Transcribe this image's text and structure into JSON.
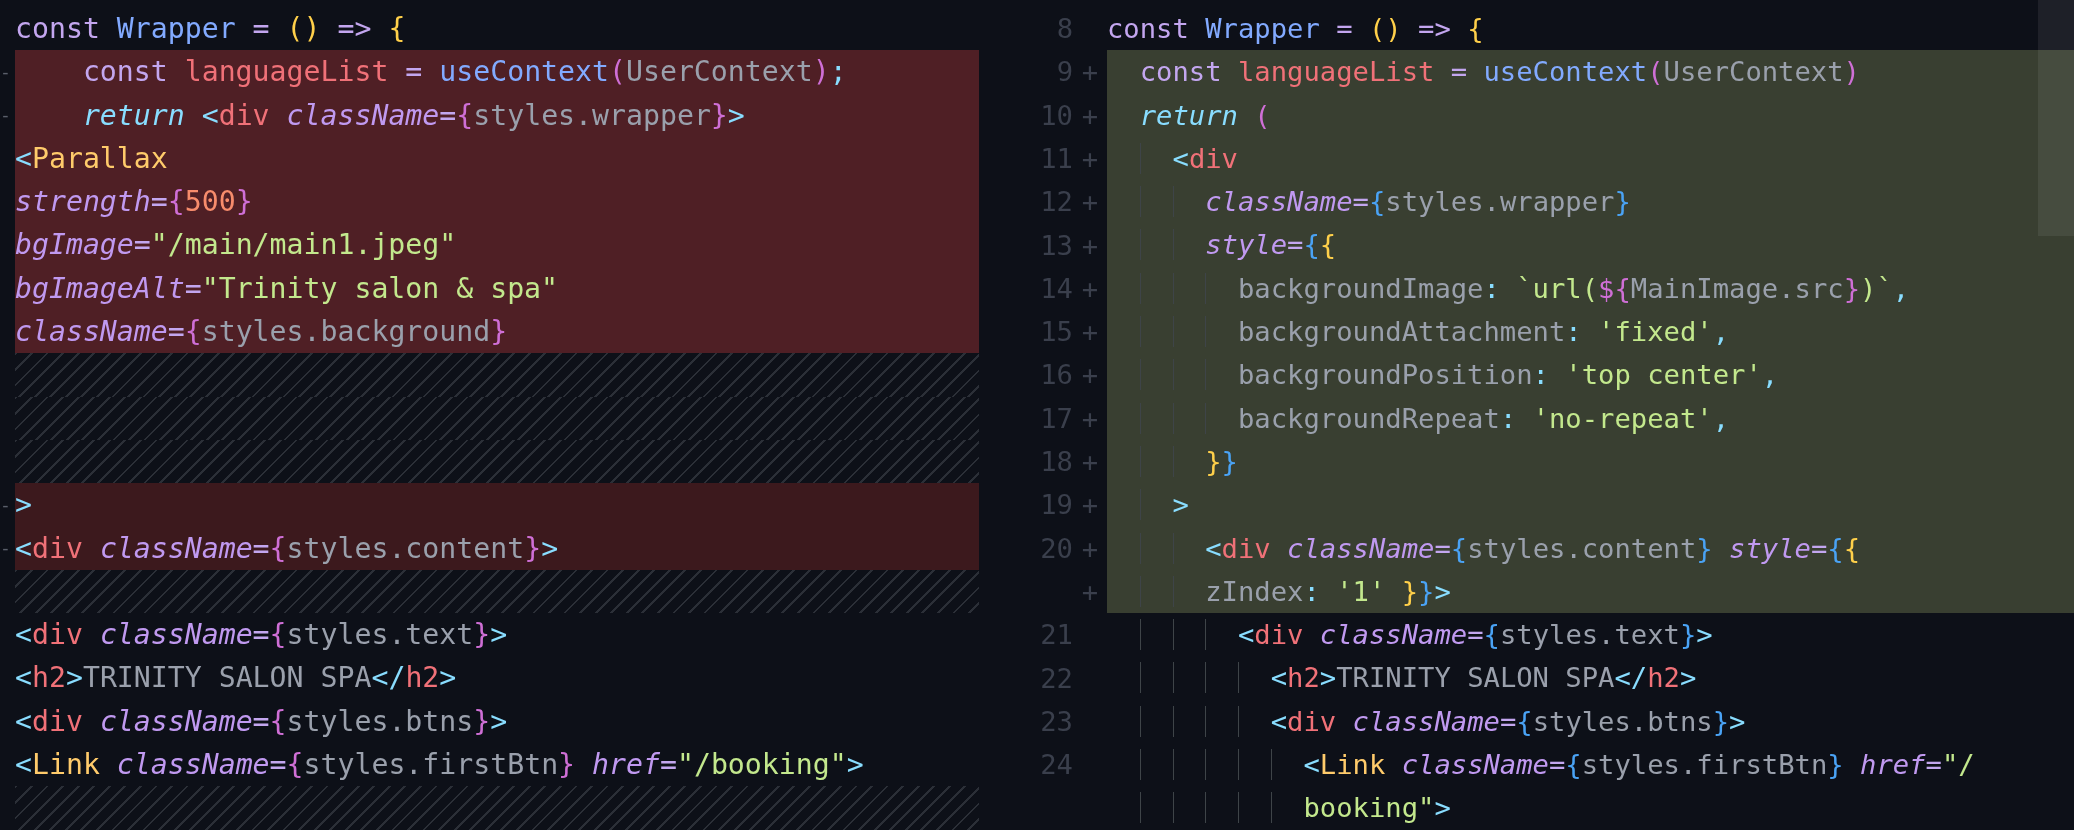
{
  "panes": [
    {
      "kind": "old",
      "lines": [
        {
          "kind": "context",
          "tokens": [
            {
              "text": "const ",
              "kind": "keyword"
            },
            {
              "text": "Wrapper",
              "kind": "function"
            },
            {
              "text": " = ",
              "kind": "op"
            },
            {
              "text": "()",
              "kind": "bracket"
            },
            {
              "text": " => ",
              "kind": "op"
            },
            {
              "text": "{",
              "kind": "bracket"
            }
          ]
        },
        {
          "kind": "removed",
          "marker": "-",
          "tokens": [
            {
              "text": "    const ",
              "kind": "keyword"
            },
            {
              "text": "languageList",
              "kind": "var"
            },
            {
              "text": " = ",
              "kind": "op"
            },
            {
              "text": "useContext",
              "kind": "function"
            },
            {
              "text": "(",
              "kind": "brace"
            },
            {
              "text": "UserContext",
              "kind": "plain"
            },
            {
              "text": ")",
              "kind": "brace"
            },
            {
              "text": ";",
              "kind": "angle"
            }
          ]
        },
        {
          "kind": "removed",
          "marker": "-",
          "tokens": [
            {
              "text": "    return ",
              "kind": "return"
            },
            {
              "text": "<",
              "kind": "angle"
            },
            {
              "text": "div ",
              "kind": "var"
            },
            {
              "text": "className",
              "kind": "attr"
            },
            {
              "text": "=",
              "kind": "op"
            },
            {
              "text": "{",
              "kind": "brace"
            },
            {
              "text": "styles.wrapper",
              "kind": "plain"
            },
            {
              "text": "}",
              "kind": "brace"
            },
            {
              "text": ">",
              "kind": "angle"
            }
          ]
        },
        {
          "kind": "removed",
          "tokens": [
            {
              "text": "<",
              "kind": "angle"
            },
            {
              "text": "Parallax",
              "kind": "component"
            }
          ]
        },
        {
          "kind": "removed",
          "tokens": [
            {
              "text": "strength",
              "kind": "attr"
            },
            {
              "text": "=",
              "kind": "op"
            },
            {
              "text": "{",
              "kind": "brace"
            },
            {
              "text": "500",
              "kind": "number"
            },
            {
              "text": "}",
              "kind": "brace"
            }
          ]
        },
        {
          "kind": "removed",
          "tokens": [
            {
              "text": "bgImage",
              "kind": "attr"
            },
            {
              "text": "=",
              "kind": "op"
            },
            {
              "text": "\"/main/main1.jpeg\"",
              "kind": "string"
            }
          ]
        },
        {
          "kind": "removed",
          "tokens": [
            {
              "text": "bgImageAlt",
              "kind": "attr"
            },
            {
              "text": "=",
              "kind": "op"
            },
            {
              "text": "\"Trinity salon & spa\"",
              "kind": "string"
            }
          ]
        },
        {
          "kind": "removed",
          "tokens": [
            {
              "text": "className",
              "kind": "attr"
            },
            {
              "text": "=",
              "kind": "op"
            },
            {
              "text": "{",
              "kind": "brace"
            },
            {
              "text": "styles.background",
              "kind": "plain"
            },
            {
              "text": "}",
              "kind": "brace"
            }
          ]
        },
        {
          "kind": "filler"
        },
        {
          "kind": "filler"
        },
        {
          "kind": "filler"
        },
        {
          "kind": "removed_dim",
          "marker": "-",
          "tokens": [
            {
              "text": ">",
              "kind": "angle"
            }
          ]
        },
        {
          "kind": "removed_dim",
          "marker": "-",
          "tokens": [
            {
              "text": "<",
              "kind": "angle"
            },
            {
              "text": "div ",
              "kind": "var"
            },
            {
              "text": "className",
              "kind": "attr"
            },
            {
              "text": "=",
              "kind": "op"
            },
            {
              "text": "{",
              "kind": "brace"
            },
            {
              "text": "styles.content",
              "kind": "plain"
            },
            {
              "text": "}",
              "kind": "brace"
            },
            {
              "text": ">",
              "kind": "angle"
            }
          ]
        },
        {
          "kind": "filler"
        },
        {
          "kind": "context",
          "tokens": [
            {
              "text": "<",
              "kind": "angle"
            },
            {
              "text": "div ",
              "kind": "var"
            },
            {
              "text": "className",
              "kind": "attr"
            },
            {
              "text": "=",
              "kind": "op"
            },
            {
              "text": "{",
              "kind": "brace"
            },
            {
              "text": "styles.text",
              "kind": "plain"
            },
            {
              "text": "}",
              "kind": "brace"
            },
            {
              "text": ">",
              "kind": "angle"
            }
          ]
        },
        {
          "kind": "context",
          "tokens": [
            {
              "text": "<",
              "kind": "angle"
            },
            {
              "text": "h2",
              "kind": "var"
            },
            {
              "text": ">",
              "kind": "angle"
            },
            {
              "text": "TRINITY SALON SPA",
              "kind": "plain"
            },
            {
              "text": "</",
              "kind": "angle"
            },
            {
              "text": "h2",
              "kind": "var"
            },
            {
              "text": ">",
              "kind": "angle"
            }
          ]
        },
        {
          "kind": "context",
          "tokens": [
            {
              "text": "<",
              "kind": "angle"
            },
            {
              "text": "div ",
              "kind": "var"
            },
            {
              "text": "className",
              "kind": "attr"
            },
            {
              "text": "=",
              "kind": "op"
            },
            {
              "text": "{",
              "kind": "brace"
            },
            {
              "text": "styles.btns",
              "kind": "plain"
            },
            {
              "text": "}",
              "kind": "brace"
            },
            {
              "text": ">",
              "kind": "angle"
            }
          ]
        },
        {
          "kind": "context",
          "tokens": [
            {
              "text": "<",
              "kind": "angle"
            },
            {
              "text": "Link ",
              "kind": "component"
            },
            {
              "text": "className",
              "kind": "attr"
            },
            {
              "text": "=",
              "kind": "op"
            },
            {
              "text": "{",
              "kind": "brace"
            },
            {
              "text": "styles.firstBtn",
              "kind": "plain"
            },
            {
              "text": "} ",
              "kind": "brace"
            },
            {
              "text": "href",
              "kind": "attr"
            },
            {
              "text": "=",
              "kind": "op"
            },
            {
              "text": "\"/booking\"",
              "kind": "string"
            },
            {
              "text": ">",
              "kind": "angle"
            }
          ]
        },
        {
          "kind": "filler"
        }
      ]
    },
    {
      "kind": "new",
      "lines": [
        {
          "kind": "context",
          "number": "8",
          "tokens": [
            {
              "text": "const ",
              "kind": "keyword"
            },
            {
              "text": "Wrapper",
              "kind": "function"
            },
            {
              "text": " = ",
              "kind": "op"
            },
            {
              "text": "()",
              "kind": "bracket"
            },
            {
              "text": " => ",
              "kind": "op"
            },
            {
              "text": "{",
              "kind": "bracket"
            }
          ]
        },
        {
          "kind": "added",
          "number": "9",
          "marker": "+",
          "tokens": [
            {
              "text": "  const ",
              "kind": "keyword"
            },
            {
              "text": "languageList",
              "kind": "var"
            },
            {
              "text": " = ",
              "kind": "op"
            },
            {
              "text": "useContext",
              "kind": "function"
            },
            {
              "text": "(",
              "kind": "brace"
            },
            {
              "text": "UserContext",
              "kind": "plain"
            },
            {
              "text": ")",
              "kind": "brace"
            }
          ]
        },
        {
          "kind": "added",
          "number": "10",
          "marker": "+",
          "tokens": [
            {
              "text": "  return ",
              "kind": "return"
            },
            {
              "text": "(",
              "kind": "brace"
            }
          ]
        },
        {
          "kind": "added",
          "number": "11",
          "marker": "+",
          "tokens": [
            {
              "text": "    <",
              "kind": "angle"
            },
            {
              "text": "div",
              "kind": "var"
            }
          ]
        },
        {
          "kind": "added",
          "number": "12",
          "marker": "+",
          "tokens": [
            {
              "text": "      className",
              "kind": "attr"
            },
            {
              "text": "=",
              "kind": "op"
            },
            {
              "text": "{",
              "kind": "brace_blue"
            },
            {
              "text": "styles.wrapper",
              "kind": "plain"
            },
            {
              "text": "}",
              "kind": "brace_blue"
            }
          ]
        },
        {
          "kind": "added",
          "number": "13",
          "marker": "+",
          "tokens": [
            {
              "text": "      style",
              "kind": "attr"
            },
            {
              "text": "=",
              "kind": "op"
            },
            {
              "text": "{",
              "kind": "brace_blue"
            },
            {
              "text": "{",
              "kind": "bracket"
            }
          ]
        },
        {
          "kind": "added",
          "number": "14",
          "marker": "+",
          "tokens": [
            {
              "text": "        backgroundImage",
              "kind": "plain"
            },
            {
              "text": ": ",
              "kind": "angle"
            },
            {
              "text": "`url(",
              "kind": "string"
            },
            {
              "text": "${",
              "kind": "brace"
            },
            {
              "text": "MainImage.src",
              "kind": "plain"
            },
            {
              "text": "}",
              "kind": "brace"
            },
            {
              "text": ")`",
              "kind": "string"
            },
            {
              "text": ",",
              "kind": "angle"
            }
          ]
        },
        {
          "kind": "added",
          "number": "15",
          "marker": "+",
          "tokens": [
            {
              "text": "        backgroundAttachment",
              "kind": "plain"
            },
            {
              "text": ": ",
              "kind": "angle"
            },
            {
              "text": "'fixed'",
              "kind": "string"
            },
            {
              "text": ",",
              "kind": "angle"
            }
          ]
        },
        {
          "kind": "added",
          "number": "16",
          "marker": "+",
          "tokens": [
            {
              "text": "        backgroundPosition",
              "kind": "plain"
            },
            {
              "text": ": ",
              "kind": "angle"
            },
            {
              "text": "'top center'",
              "kind": "string"
            },
            {
              "text": ",",
              "kind": "angle"
            }
          ]
        },
        {
          "kind": "added",
          "number": "17",
          "marker": "+",
          "tokens": [
            {
              "text": "        backgroundRepeat",
              "kind": "plain"
            },
            {
              "text": ": ",
              "kind": "angle"
            },
            {
              "text": "'no-repeat'",
              "kind": "string"
            },
            {
              "text": ",",
              "kind": "angle"
            }
          ]
        },
        {
          "kind": "added",
          "number": "18",
          "marker": "+",
          "tokens": [
            {
              "text": "      }",
              "kind": "bracket"
            },
            {
              "text": "}",
              "kind": "brace_blue"
            }
          ]
        },
        {
          "kind": "added",
          "number": "19",
          "marker": "+",
          "tokens": [
            {
              "text": "    >",
              "kind": "angle"
            }
          ]
        },
        {
          "kind": "added",
          "number": "20",
          "marker": "+",
          "tokens": [
            {
              "text": "      <",
              "kind": "angle"
            },
            {
              "text": "div ",
              "kind": "var"
            },
            {
              "text": "className",
              "kind": "attr"
            },
            {
              "text": "=",
              "kind": "op"
            },
            {
              "text": "{",
              "kind": "brace_blue"
            },
            {
              "text": "styles.content",
              "kind": "plain"
            },
            {
              "text": "} ",
              "kind": "brace_blue"
            },
            {
              "text": "style",
              "kind": "attr"
            },
            {
              "text": "=",
              "kind": "op"
            },
            {
              "text": "{",
              "kind": "brace_blue"
            },
            {
              "text": "{",
              "kind": "bracket"
            }
          ]
        },
        {
          "kind": "added",
          "marker": "+",
          "tokens": [
            {
              "text": "      zIndex",
              "kind": "plain"
            },
            {
              "text": ": ",
              "kind": "angle"
            },
            {
              "text": "'1'",
              "kind": "string"
            },
            {
              "text": " }",
              "kind": "bracket"
            },
            {
              "text": "}",
              "kind": "brace_blue"
            },
            {
              "text": ">",
              "kind": "angle"
            }
          ]
        },
        {
          "kind": "context",
          "number": "21",
          "tokens": [
            {
              "text": "        <",
              "kind": "angle"
            },
            {
              "text": "div ",
              "kind": "var"
            },
            {
              "text": "className",
              "kind": "attr"
            },
            {
              "text": "=",
              "kind": "op"
            },
            {
              "text": "{",
              "kind": "brace_blue"
            },
            {
              "text": "styles.text",
              "kind": "plain"
            },
            {
              "text": "}",
              "kind": "brace_blue"
            },
            {
              "text": ">",
              "kind": "angle"
            }
          ]
        },
        {
          "kind": "context",
          "number": "22",
          "tokens": [
            {
              "text": "          <",
              "kind": "angle"
            },
            {
              "text": "h2",
              "kind": "var"
            },
            {
              "text": ">",
              "kind": "angle"
            },
            {
              "text": "TRINITY SALON SPA",
              "kind": "plain"
            },
            {
              "text": "</",
              "kind": "angle"
            },
            {
              "text": "h2",
              "kind": "var"
            },
            {
              "text": ">",
              "kind": "angle"
            }
          ]
        },
        {
          "kind": "context",
          "number": "23",
          "tokens": [
            {
              "text": "          <",
              "kind": "angle"
            },
            {
              "text": "div ",
              "kind": "var"
            },
            {
              "text": "className",
              "kind": "attr"
            },
            {
              "text": "=",
              "kind": "op"
            },
            {
              "text": "{",
              "kind": "brace_blue"
            },
            {
              "text": "styles.btns",
              "kind": "plain"
            },
            {
              "text": "}",
              "kind": "brace_blue"
            },
            {
              "text": ">",
              "kind": "angle"
            }
          ]
        },
        {
          "kind": "context",
          "number": "24",
          "tokens": [
            {
              "text": "            <",
              "kind": "angle"
            },
            {
              "text": "Link ",
              "kind": "component"
            },
            {
              "text": "className",
              "kind": "attr"
            },
            {
              "text": "=",
              "kind": "op"
            },
            {
              "text": "{",
              "kind": "brace_blue"
            },
            {
              "text": "styles.firstBtn",
              "kind": "plain"
            },
            {
              "text": "} ",
              "kind": "brace_blue"
            },
            {
              "text": "href",
              "kind": "attr"
            },
            {
              "text": "=",
              "kind": "op"
            },
            {
              "text": "\"/",
              "kind": "string"
            }
          ]
        },
        {
          "kind": "context",
          "tokens": [
            {
              "text": "            booking\"",
              "kind": "string"
            },
            {
              "text": ">",
              "kind": "angle"
            }
          ]
        }
      ]
    }
  ]
}
